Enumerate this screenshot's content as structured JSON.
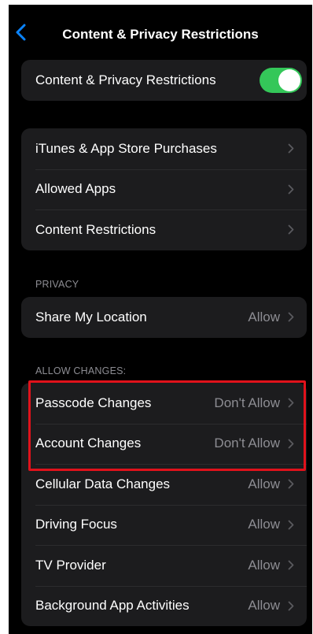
{
  "nav": {
    "title": "Content & Privacy Restrictions",
    "back_icon": "chevron-left-icon"
  },
  "master_toggle": {
    "label": "Content & Privacy Restrictions",
    "state": "on",
    "color": "#34c759"
  },
  "store_group": [
    {
      "label": "iTunes & App Store Purchases"
    },
    {
      "label": "Allowed Apps"
    },
    {
      "label": "Content Restrictions"
    }
  ],
  "privacy": {
    "header": "PRIVACY",
    "items": [
      {
        "label": "Share My Location",
        "value": "Allow"
      }
    ]
  },
  "allow_changes": {
    "header": "ALLOW CHANGES:",
    "items": [
      {
        "label": "Passcode Changes",
        "value": "Don't Allow"
      },
      {
        "label": "Account Changes",
        "value": "Don't Allow"
      },
      {
        "label": "Cellular Data Changes",
        "value": "Allow"
      },
      {
        "label": "Driving Focus",
        "value": "Allow"
      },
      {
        "label": "TV Provider",
        "value": "Allow"
      },
      {
        "label": "Background App Activities",
        "value": "Allow"
      }
    ]
  },
  "colors": {
    "accent": "#0a84ff",
    "highlight": "#e0121b",
    "background": "#000000",
    "cell": "#1c1c1e"
  }
}
